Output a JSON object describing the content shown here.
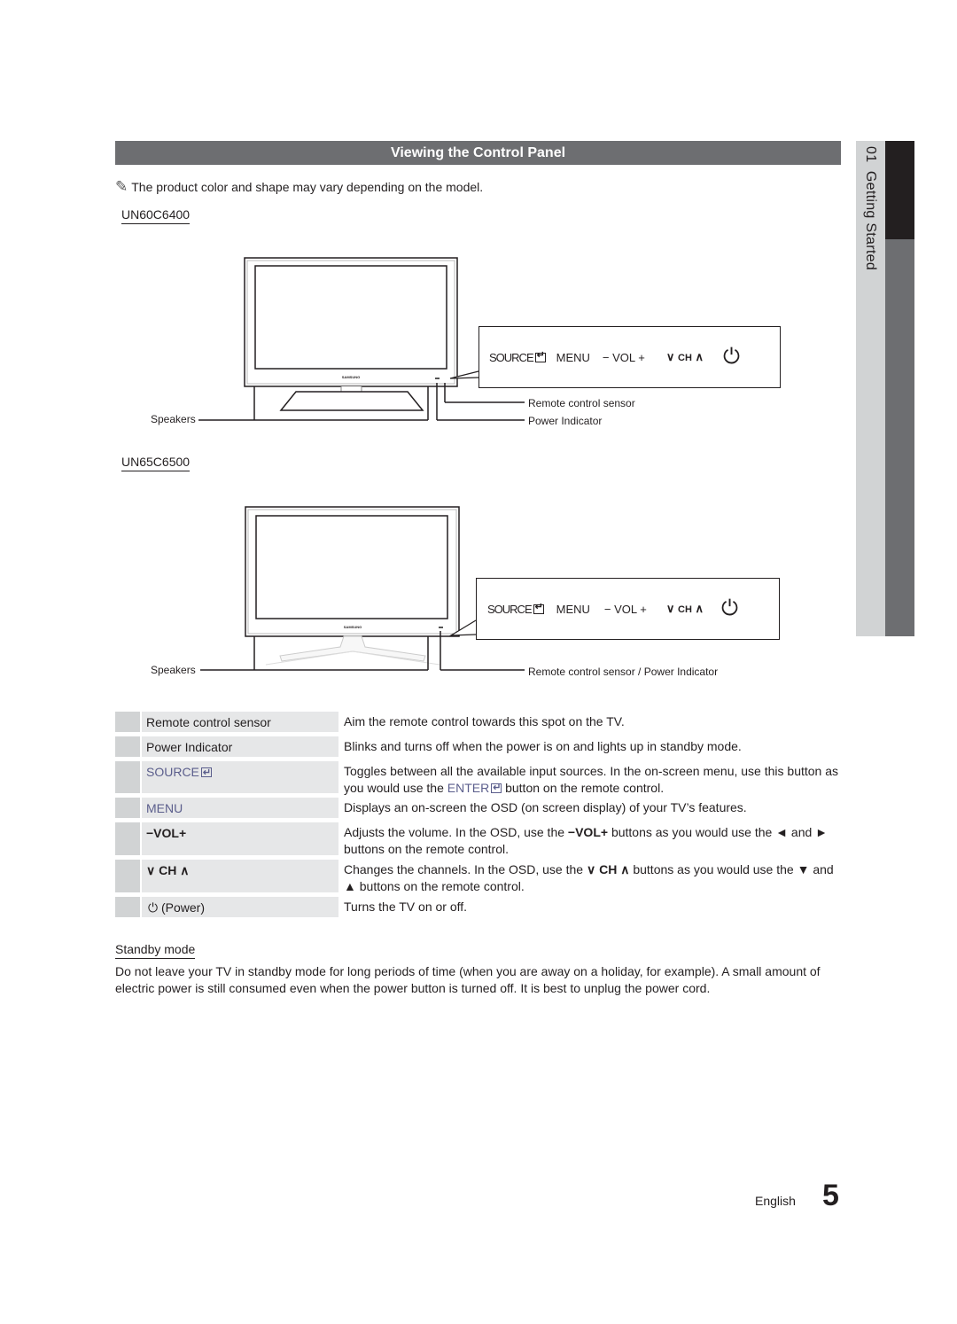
{
  "section": {
    "chapter_number": "01",
    "chapter_title": "Getting Started",
    "title": "Viewing the Control Panel",
    "note_icon": "pencil-note-icon",
    "note": "The product color and shape may vary depending on the model."
  },
  "models": [
    {
      "name": "UN60C6400",
      "brand_label": "SAMSUNG",
      "speakers_label": "Speakers",
      "callouts": [
        "Remote control sensor",
        "Power Indicator"
      ],
      "panel": {
        "source": "SOURCE",
        "menu": "MENU",
        "vol": "VOL",
        "vol_minus": "−",
        "vol_plus": "+",
        "ch": "CH",
        "ch_down": "∨",
        "ch_up": "∧",
        "power_icon": "power-icon"
      }
    },
    {
      "name": "UN65C6500",
      "brand_label": "SAMSUNG",
      "speakers_label": "Speakers",
      "callouts": [
        "Remote control sensor / Power Indicator"
      ],
      "panel": {
        "source": "SOURCE",
        "menu": "MENU",
        "vol": "VOL",
        "vol_minus": "−",
        "vol_plus": "+",
        "ch": "CH",
        "ch_down": "∨",
        "ch_up": "∧",
        "power_icon": "power-icon"
      }
    }
  ],
  "table": [
    {
      "label": "Remote control sensor",
      "desc": "Aim the remote control towards this spot on the TV."
    },
    {
      "label": "Power Indicator",
      "desc": "Blinks and turns off when the power is on and lights up in standby mode."
    },
    {
      "label": "SOURCE",
      "desc_a": "Toggles between all the available input sources. In the on-screen menu, use this button as you would use the ",
      "desc_enter": "ENTER",
      "desc_b": " button on the remote control."
    },
    {
      "label": "MENU",
      "desc": "Displays an on-screen the OSD (on screen display) of your TV’s features."
    },
    {
      "label": "−VOL+",
      "desc_a": "Adjusts the volume. In the OSD, use the ",
      "desc_key": "−VOL+",
      "desc_b": " buttons as you would use the ◄ and ► buttons on the remote control."
    },
    {
      "label": "∨ CH ∧",
      "desc_a": "Changes the channels. In the OSD, use the ",
      "desc_key": "∨ CH ∧",
      "desc_b": " buttons as you would use the ▼ and ▲ buttons on the remote control."
    },
    {
      "label": "(Power)",
      "desc": "Turns the TV on or off."
    }
  ],
  "standby": {
    "title": "Standby mode",
    "text": "Do not leave your TV in standby mode for long periods of time (when you are away on a holiday, for example). A small amount of electric power is still consumed even when the power button is turned off. It is best to unplug the power cord."
  },
  "footer": {
    "language": "English",
    "page_number": "5"
  }
}
